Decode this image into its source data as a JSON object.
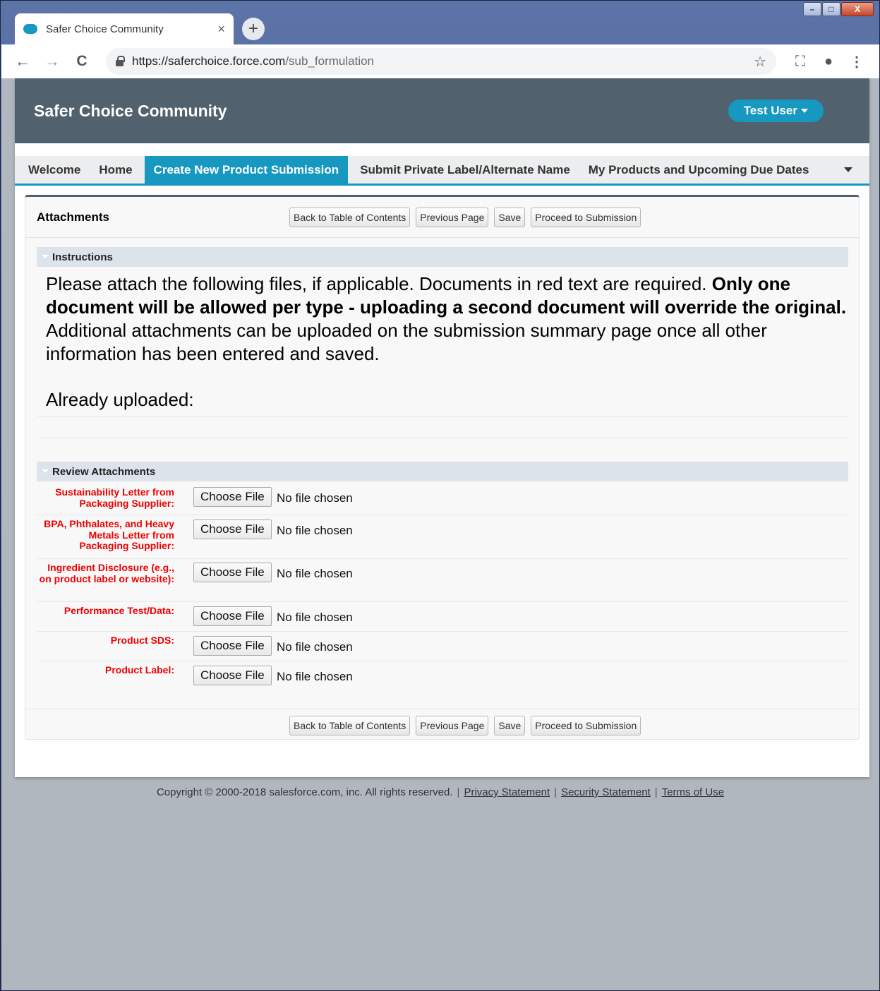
{
  "browser": {
    "tab_title": "Safer Choice Community",
    "tab_close": "×",
    "new_tab": "+",
    "url_host": "https://saferchoice.force.com",
    "url_path": "/sub_formulation",
    "window_controls": {
      "minimize": "–",
      "maximize": "□",
      "close": "X"
    },
    "nav": {
      "back": "←",
      "forward": "→",
      "reload": "C"
    },
    "icons": {
      "bookmark": "☆",
      "cast": "⛶",
      "account": "●",
      "menu": "⋮"
    }
  },
  "header": {
    "brand": "Safer Choice Community",
    "user_menu": "Test User"
  },
  "nav_tabs": [
    {
      "label": "Welcome"
    },
    {
      "label": "Home"
    },
    {
      "label": "Create New Product Submission",
      "active": true
    },
    {
      "label": "Submit Private Label/Alternate Name"
    },
    {
      "label": "My Products and Upcoming Due Dates"
    }
  ],
  "page": {
    "title": "Attachments",
    "buttons": {
      "back_toc": "Back to Table of Contents",
      "previous": "Previous Page",
      "save": "Save",
      "proceed": "Proceed to Submission"
    },
    "instructions": {
      "heading": "Instructions",
      "text_1": "Please attach the following files, if applicable. Documents in red text are required. ",
      "text_bold": "Only one document will be allowed per type - uploading a second document will override the original.",
      "text_2": " Additional attachments can be uploaded on the submission summary page once all other information has been entered and saved.",
      "already_uploaded": "Already uploaded:"
    },
    "review": {
      "heading": "Review Attachments",
      "choose_label": "Choose File",
      "no_file": "No file chosen",
      "items": [
        {
          "label": "Sustainability Letter from Packaging Supplier:"
        },
        {
          "label": "BPA, Phthalates, and Heavy Metals Letter from Packaging Supplier:"
        },
        {
          "label": "Ingredient Disclosure (e.g., on product label or website):"
        },
        {
          "label": "Performance Test/Data:"
        },
        {
          "label": "Product SDS:"
        },
        {
          "label": "Product Label:"
        }
      ]
    }
  },
  "footer": {
    "copyright": "Copyright © 2000-2018 salesforce.com, inc. All rights reserved.",
    "privacy": "Privacy Statement",
    "security": "Security Statement",
    "terms": "Terms of Use"
  },
  "colors": {
    "accent": "#1798c1",
    "header": "#52616e",
    "required": "#ee0000"
  }
}
